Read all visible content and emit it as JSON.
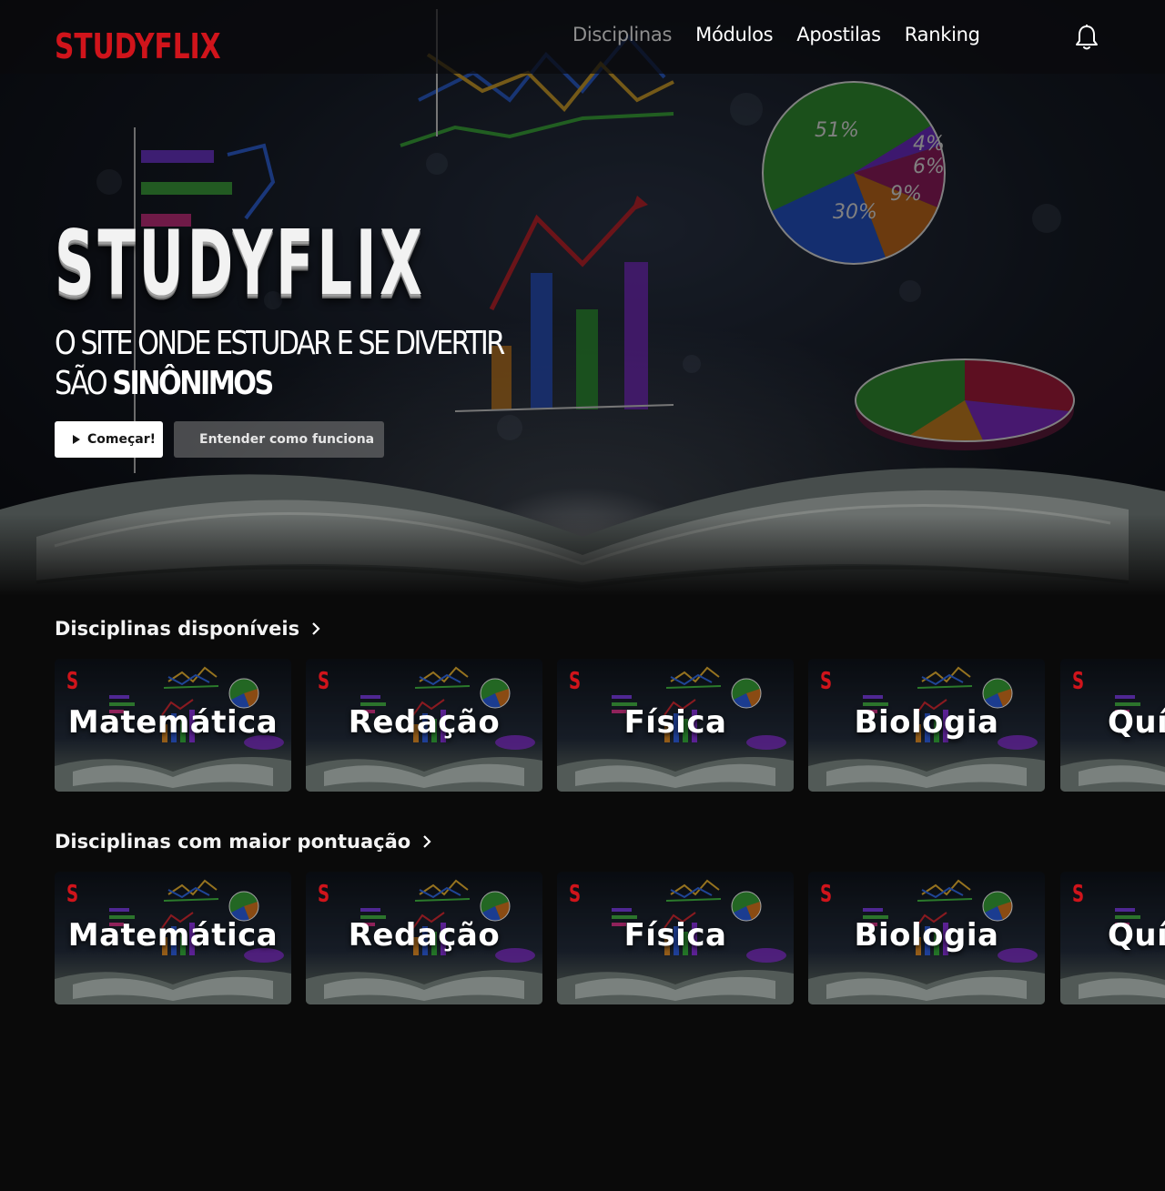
{
  "brand": {
    "logo": "STUDYFLIX",
    "color": "#d0141b"
  },
  "nav": {
    "links": [
      {
        "label": "Disciplinas",
        "active": true
      },
      {
        "label": "Módulos",
        "active": false
      },
      {
        "label": "Apostilas",
        "active": false
      },
      {
        "label": "Ranking",
        "active": false
      }
    ],
    "notification_icon": "bell-icon"
  },
  "hero": {
    "title": "STUDYFLIX",
    "subtitle_line1": "O SITE ONDE ESTUDAR E SE DIVERTIR",
    "subtitle_line2_prefix": "SÃO ",
    "subtitle_line2_strong": "SINÔNIMOS",
    "primary_button": {
      "label": "Começar!",
      "icon": "play-icon"
    },
    "secondary_button": {
      "label": "Entender como funciona",
      "icon": "info-icon"
    },
    "background_art": {
      "pie_labels": [
        "51%",
        "30%",
        "9%",
        "6%",
        "4%"
      ]
    }
  },
  "rows": [
    {
      "title": "Disciplinas disponíveis",
      "cards": [
        {
          "badge": "S",
          "label": "Matemática"
        },
        {
          "badge": "S",
          "label": "Redação"
        },
        {
          "badge": "S",
          "label": "Física"
        },
        {
          "badge": "S",
          "label": "Biologia"
        },
        {
          "badge": "S",
          "label": "Quí"
        }
      ]
    },
    {
      "title": "Disciplinas com maior pontuação",
      "cards": [
        {
          "badge": "S",
          "label": "Matemática"
        },
        {
          "badge": "S",
          "label": "Redação"
        },
        {
          "badge": "S",
          "label": "Física"
        },
        {
          "badge": "S",
          "label": "Biologia"
        },
        {
          "badge": "S",
          "label": "Quí"
        }
      ]
    }
  ]
}
